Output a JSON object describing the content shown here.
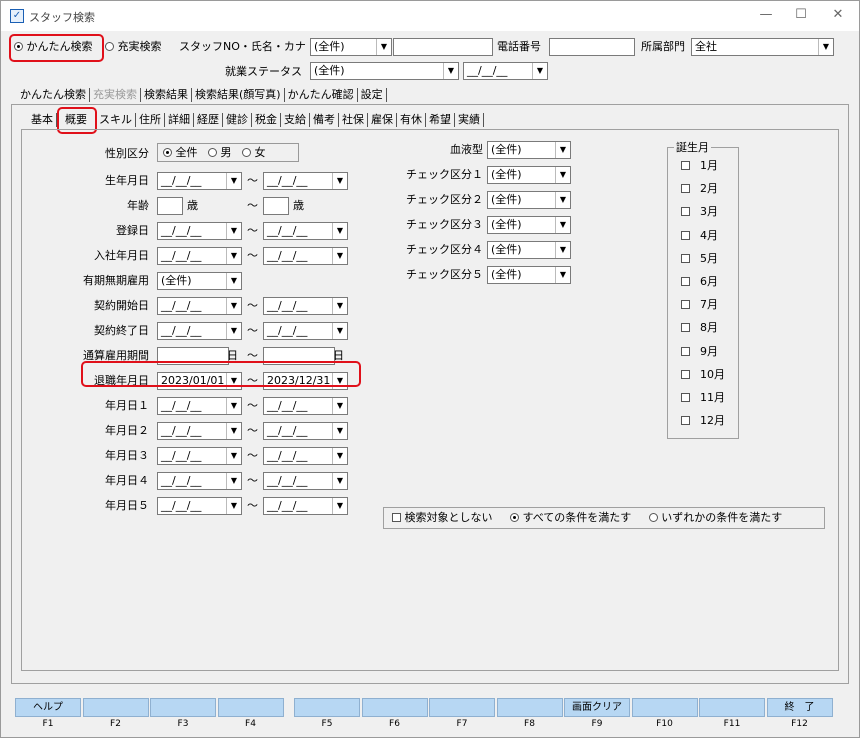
{
  "window": {
    "title": "スタッフ検索",
    "minimize": "—",
    "maximize": "☐",
    "close": "✕"
  },
  "search_mode": {
    "simple": "かんたん検索",
    "full": "充実検索",
    "selected": "simple"
  },
  "staff_field": {
    "label": "スタッフNO・氏名・カナ",
    "select_value": "(全件)",
    "text_value": ""
  },
  "phone": {
    "label": "電話番号",
    "value": ""
  },
  "department": {
    "label": "所属部門",
    "value": "全社"
  },
  "employment_status": {
    "label": "就業ステータス",
    "value": "(全件)",
    "date_value": "__/__/__"
  },
  "main_tabs": [
    "かんたん検索",
    "充実検索",
    "検索結果",
    "検索結果(顔写真)",
    "かんたん確認",
    "設定"
  ],
  "sub_tabs": [
    "基本",
    "概要",
    "スキル",
    "住所",
    "詳細",
    "経歴",
    "健診",
    "税金",
    "支給",
    "備考",
    "社保",
    "雇保",
    "有休",
    "希望",
    "実績"
  ],
  "sub_tab_active": "概要",
  "form": {
    "gender": {
      "label": "性別区分",
      "options": [
        "全件",
        "男",
        "女"
      ],
      "selected": "全件"
    },
    "birth_date": {
      "label": "生年月日",
      "from": "__/__/__",
      "to": "__/__/__"
    },
    "age": {
      "label": "年齢",
      "from": "",
      "to": "",
      "unit": "歳"
    },
    "registration_date": {
      "label": "登録日",
      "from": "__/__/__",
      "to": "__/__/__"
    },
    "hire_date": {
      "label": "入社年月日",
      "from": "__/__/__",
      "to": "__/__/__"
    },
    "contract_type": {
      "label": "有期無期雇用",
      "value": "(全件)"
    },
    "contract_start": {
      "label": "契約開始日",
      "from": "__/__/__",
      "to": "__/__/__"
    },
    "contract_end": {
      "label": "契約終了日",
      "from": "__/__/__",
      "to": "__/__/__"
    },
    "employment_period": {
      "label": "通算雇用期間",
      "from": "",
      "to": "",
      "unit": "日"
    },
    "retirement_date": {
      "label": "退職年月日",
      "from": "2023/01/01",
      "to": "2023/12/31"
    },
    "date1": {
      "label": "年月日１",
      "from": "__/__/__",
      "to": "__/__/__"
    },
    "date2": {
      "label": "年月日２",
      "from": "__/__/__",
      "to": "__/__/__"
    },
    "date3": {
      "label": "年月日３",
      "from": "__/__/__",
      "to": "__/__/__"
    },
    "date4": {
      "label": "年月日４",
      "from": "__/__/__",
      "to": "__/__/__"
    },
    "date5": {
      "label": "年月日５",
      "from": "__/__/__",
      "to": "__/__/__"
    },
    "tilde": "～"
  },
  "right_form": {
    "blood_type": {
      "label": "血液型",
      "value": "(全件)"
    },
    "check1": {
      "label": "チェック区分１",
      "value": "(全件)"
    },
    "check2": {
      "label": "チェック区分２",
      "value": "(全件)"
    },
    "check3": {
      "label": "チェック区分３",
      "value": "(全件)"
    },
    "check4": {
      "label": "チェック区分４",
      "value": "(全件)"
    },
    "check5": {
      "label": "チェック区分５",
      "value": "(全件)"
    }
  },
  "birth_month": {
    "label": "誕生月",
    "months": [
      "1月",
      "2月",
      "3月",
      "4月",
      "5月",
      "6月",
      "7月",
      "8月",
      "9月",
      "10月",
      "11月",
      "12月"
    ]
  },
  "conditions": {
    "exclude": "検索対象としない",
    "all": "すべての条件を満たす",
    "any": "いずれかの条件を満たす",
    "selected": "all"
  },
  "fkeys": [
    {
      "key": "F1",
      "label": "ヘルプ"
    },
    {
      "key": "F2",
      "label": ""
    },
    {
      "key": "F3",
      "label": ""
    },
    {
      "key": "F4",
      "label": ""
    },
    {
      "key": "F5",
      "label": ""
    },
    {
      "key": "F6",
      "label": ""
    },
    {
      "key": "F7",
      "label": ""
    },
    {
      "key": "F8",
      "label": ""
    },
    {
      "key": "F9",
      "label": "画面クリア"
    },
    {
      "key": "F10",
      "label": ""
    },
    {
      "key": "F11",
      "label": ""
    },
    {
      "key": "F12",
      "label": "終　了"
    }
  ]
}
